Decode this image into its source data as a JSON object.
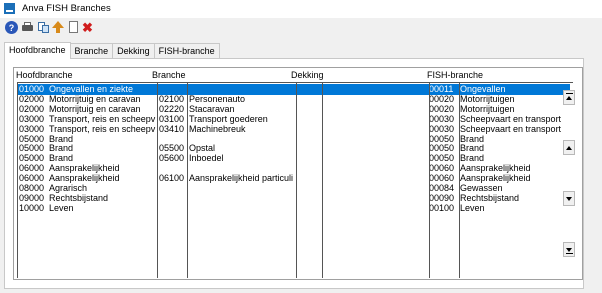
{
  "window": {
    "title": "Anva FISH Branches"
  },
  "toolbar": {
    "icons": [
      "help-icon",
      "print-icon",
      "copy-icon",
      "up-icon",
      "new-document-icon",
      "delete-icon"
    ]
  },
  "tabs": [
    {
      "label": "Hoofdbranche",
      "active": true
    },
    {
      "label": "Branche",
      "active": false
    },
    {
      "label": "Dekking",
      "active": false
    },
    {
      "label": "FISH-branche",
      "active": false
    }
  ],
  "grid": {
    "headers": {
      "hoofdbranche": "Hoofdbranche",
      "branche": "Branche",
      "dekking": "Dekking",
      "fish": "FISH-branche"
    },
    "rows": [
      {
        "hb_code": "01000",
        "hb_name": "Ongevallen en ziekte",
        "br_code": "",
        "br_name": "",
        "fish_code": "00011",
        "fish_name": "Ongevallen",
        "selected": true
      },
      {
        "hb_code": "02000",
        "hb_name": "Motorrijtuig en caravan",
        "br_code": "02100",
        "br_name": "Personenauto",
        "fish_code": "00020",
        "fish_name": "Motorrijtuigen",
        "selected": false
      },
      {
        "hb_code": "02000",
        "hb_name": "Motorrijtuig en caravan",
        "br_code": "02220",
        "br_name": "Stacaravan",
        "fish_code": "00020",
        "fish_name": "Motorrijtuigen",
        "selected": false
      },
      {
        "hb_code": "03000",
        "hb_name": "Transport, reis en scheepv",
        "br_code": "03100",
        "br_name": "Transport goederen",
        "fish_code": "00030",
        "fish_name": "Scheepvaart en transport",
        "selected": false
      },
      {
        "hb_code": "03000",
        "hb_name": "Transport, reis en scheepv",
        "br_code": "03410",
        "br_name": "Machinebreuk",
        "fish_code": "00030",
        "fish_name": "Scheepvaart en transport",
        "selected": false
      },
      {
        "hb_code": "05000",
        "hb_name": "Brand",
        "br_code": "",
        "br_name": "",
        "fish_code": "00050",
        "fish_name": "Brand",
        "selected": false
      },
      {
        "hb_code": "05000",
        "hb_name": "Brand",
        "br_code": "05500",
        "br_name": "Opstal",
        "fish_code": "00050",
        "fish_name": "Brand",
        "selected": false
      },
      {
        "hb_code": "05000",
        "hb_name": "Brand",
        "br_code": "05600",
        "br_name": "Inboedel",
        "fish_code": "00050",
        "fish_name": "Brand",
        "selected": false
      },
      {
        "hb_code": "06000",
        "hb_name": "Aansprakelijkheid",
        "br_code": "",
        "br_name": "",
        "fish_code": "00060",
        "fish_name": "Aansprakelijkheid",
        "selected": false
      },
      {
        "hb_code": "06000",
        "hb_name": "Aansprakelijkheid",
        "br_code": "06100",
        "br_name": "Aansprakelijkheid particuli",
        "fish_code": "00060",
        "fish_name": "Aansprakelijkheid",
        "selected": false
      },
      {
        "hb_code": "08000",
        "hb_name": "Agrarisch",
        "br_code": "",
        "br_name": "",
        "fish_code": "00084",
        "fish_name": "Gewassen",
        "selected": false
      },
      {
        "hb_code": "09000",
        "hb_name": "Rechtsbijstand",
        "br_code": "",
        "br_name": "",
        "fish_code": "00090",
        "fish_name": "Rechtsbijstand",
        "selected": false
      },
      {
        "hb_code": "10000",
        "hb_name": "Leven",
        "br_code": "",
        "br_name": "",
        "fish_code": "00100",
        "fish_name": "Leven",
        "selected": false
      }
    ]
  },
  "colors": {
    "selection": "#0078d7",
    "delete": "#d01c1c",
    "help": "#2a57b8"
  }
}
